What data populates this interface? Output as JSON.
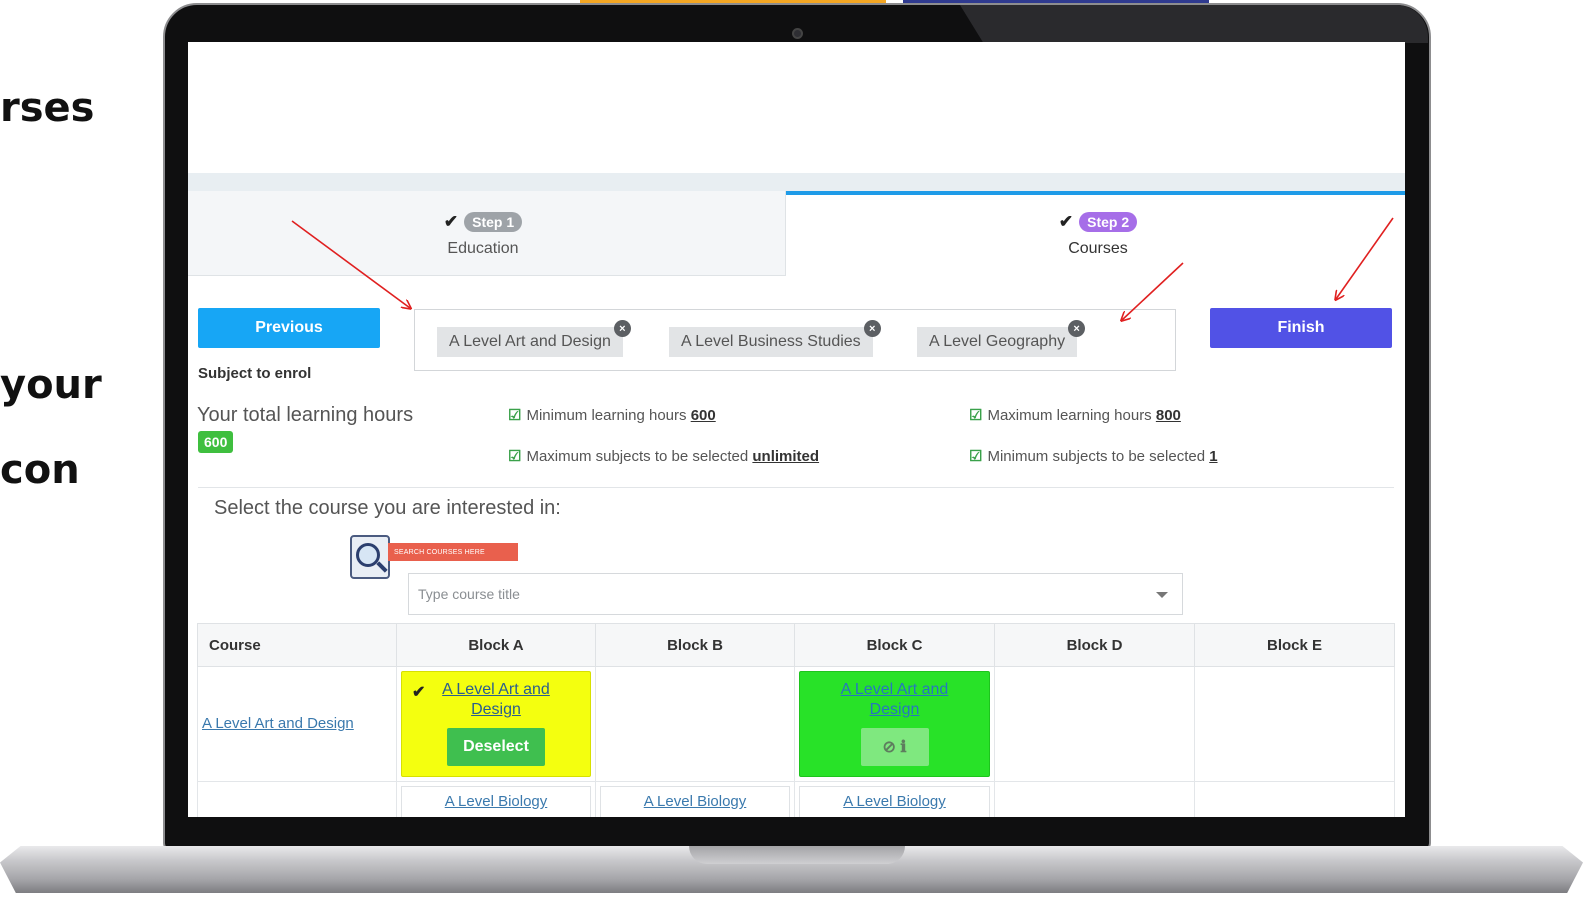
{
  "side_text": [
    "rses",
    "your",
    "con"
  ],
  "accent_colors": {
    "orange": "#f4a623",
    "navy": "#2f3a8f",
    "red_arrow": "#e02020"
  },
  "tabs": [
    {
      "check": "✔",
      "step": "Step 1",
      "label": "Education",
      "pill_color": "#9ea3a8"
    },
    {
      "check": "✔",
      "step": "Step 2",
      "label": "Courses",
      "pill_color": "#a66ee8"
    }
  ],
  "buttons": {
    "previous": "Previous",
    "finish": "Finish"
  },
  "selected_courses": [
    {
      "label": "A Level Art and Design",
      "remove_icon": "×"
    },
    {
      "label": "A Level Business Studies",
      "remove_icon": "×"
    },
    {
      "label": "A Level Geography",
      "remove_icon": "×"
    }
  ],
  "enrol_label": "Subject to enrol",
  "total_hours_label": "Your total learning hours",
  "total_hours_value": "600",
  "rules": [
    {
      "text": "Minimum learning hours ",
      "value": "600"
    },
    {
      "text": "Maximum learning hours ",
      "value": "800"
    },
    {
      "text": "Maximum subjects to be selected ",
      "value": "unlimited"
    },
    {
      "text": "Minimum subjects to be selected ",
      "value": "1"
    }
  ],
  "select_prompt": "Select the course you are interested in:",
  "search_banner": "SEARCH COURSES HERE",
  "search": {
    "placeholder": "Type course title"
  },
  "table": {
    "headers": [
      "Course",
      "Block A",
      "Block B",
      "Block C",
      "Block D",
      "Block E"
    ],
    "row1": {
      "course": "A Level Art and Design",
      "block_a": {
        "check": "✔",
        "label": "A Level Art and Design",
        "button": "Deselect"
      },
      "block_c": {
        "label": "A Level Art and Design",
        "icons": "⊘ ℹ"
      }
    },
    "row2": {
      "block_a": "A Level Biology",
      "block_b": "A Level Biology",
      "block_c": "A Level Biology"
    }
  }
}
